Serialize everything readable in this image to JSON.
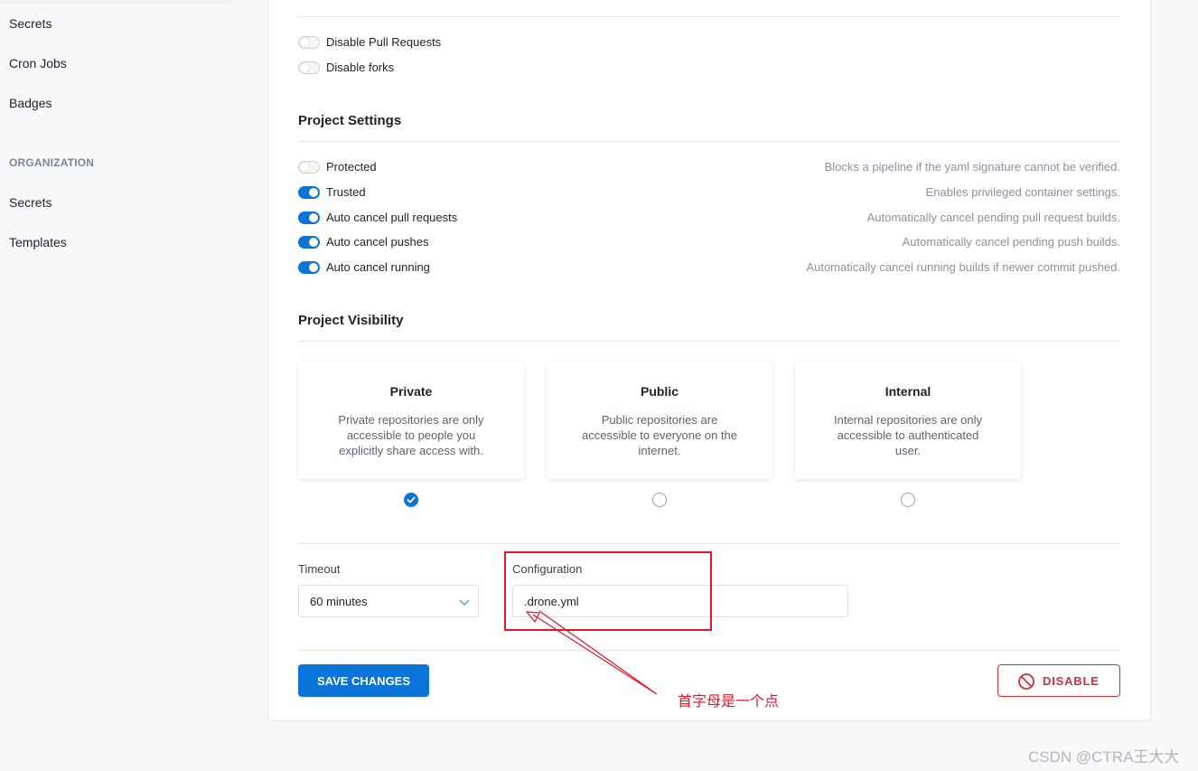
{
  "sidebar": {
    "items": [
      {
        "label": "Secrets"
      },
      {
        "label": "Cron Jobs"
      },
      {
        "label": "Badges"
      }
    ],
    "org_section": "ORGANIZATION",
    "org_items": [
      {
        "label": "Secrets"
      },
      {
        "label": "Templates"
      }
    ]
  },
  "webhooks": {
    "toggles": [
      {
        "label": "Disable Pull Requests",
        "on": false
      },
      {
        "label": "Disable forks",
        "on": false
      }
    ]
  },
  "settings": {
    "title": "Project Settings",
    "toggles": [
      {
        "label": "Protected",
        "desc": "Blocks a pipeline if the yaml signature cannot be verified.",
        "on": false
      },
      {
        "label": "Trusted",
        "desc": "Enables privileged container settings.",
        "on": true
      },
      {
        "label": "Auto cancel pull requests",
        "desc": "Automatically cancel pending pull request builds.",
        "on": true
      },
      {
        "label": "Auto cancel pushes",
        "desc": "Automatically cancel pending push builds.",
        "on": true
      },
      {
        "label": "Auto cancel running",
        "desc": "Automatically cancel running builds if newer commit pushed.",
        "on": true
      }
    ]
  },
  "visibility": {
    "title": "Project Visibility",
    "options": [
      {
        "title": "Private",
        "desc": "Private repositories are only accessible to people you explicitly share access with.",
        "selected": true
      },
      {
        "title": "Public",
        "desc": "Public repositories are accessible to everyone on the internet.",
        "selected": false
      },
      {
        "title": "Internal",
        "desc": "Internal repositories are only accessible to authenticated user.",
        "selected": false
      }
    ]
  },
  "timeout": {
    "label": "Timeout",
    "value": "60 minutes"
  },
  "configuration": {
    "label": "Configuration",
    "value": ".drone.yml"
  },
  "actions": {
    "save_label": "SAVE CHANGES",
    "disable_label": "DISABLE"
  },
  "annotation": {
    "text": "首字母是一个点"
  },
  "watermark": "CSDN @CTRA王大大",
  "colors": {
    "accent": "#0b74d8",
    "danger": "#d92b3a",
    "annotation": "#e0162b"
  }
}
